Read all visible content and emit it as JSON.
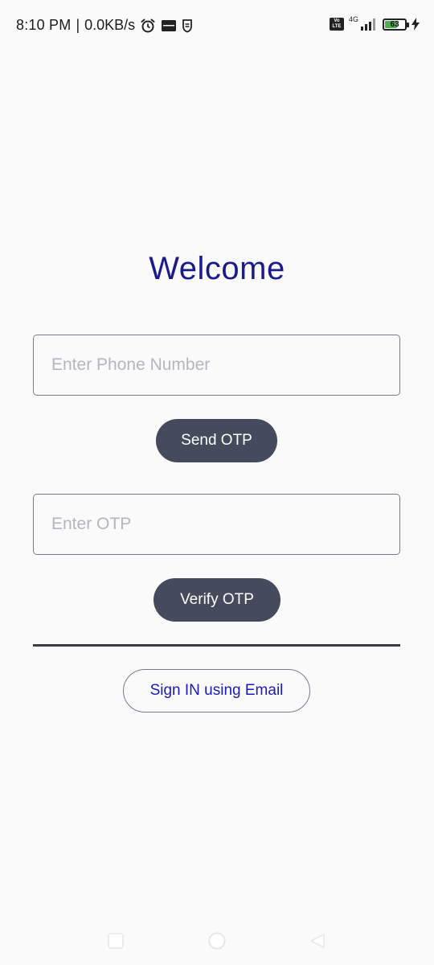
{
  "status_bar": {
    "time": "8:10 PM",
    "separator": "|",
    "network_speed": "0.0KB/s",
    "left_icons": [
      "alarm-icon",
      "app-notification-icon",
      "shield-notification-icon"
    ],
    "volte_label_top": "Vo",
    "volte_label_bottom": "LTE",
    "network_type": "4G",
    "battery_level": "63",
    "battery_color": "#4caf50",
    "charging": true
  },
  "main": {
    "title": "Welcome",
    "phone_field": {
      "placeholder": "Enter Phone Number",
      "value": ""
    },
    "send_otp_label": "Send OTP",
    "otp_field": {
      "placeholder": "Enter OTP",
      "value": ""
    },
    "verify_otp_label": "Verify OTP",
    "email_signin_label": "Sign IN using Email"
  },
  "colors": {
    "title": "#1a1a8c",
    "primary_button": "#454a5c",
    "link_text": "#1a1ab8",
    "background": "#fafafa"
  },
  "nav_bar": {
    "buttons": [
      "recents-icon",
      "home-icon",
      "back-icon"
    ]
  }
}
